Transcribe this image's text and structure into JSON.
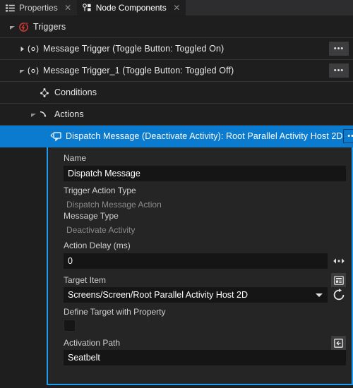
{
  "window": {
    "background": "#1e1e1e",
    "accent": "#0a7bce",
    "panel_border": "#1d9bf0"
  },
  "tabs": [
    {
      "label": "Properties",
      "icon": "list-properties-icon",
      "active": false,
      "close": "✕"
    },
    {
      "label": "Node Components",
      "icon": "node-components-icon",
      "active": true,
      "close": "✕"
    }
  ],
  "tree": [
    {
      "name": "triggers-root",
      "label": "Triggers",
      "icon": "triggers-icon",
      "twisty": "expanded",
      "indent": 0,
      "selected": false,
      "has_menu": false
    },
    {
      "name": "message-trigger",
      "label": "Message Trigger (Toggle Button: Toggled On)",
      "icon": "message-trigger-icon",
      "twisty": "collapsed",
      "indent": 1,
      "selected": false,
      "has_menu": true,
      "menu_label": "•••"
    },
    {
      "name": "message-trigger-1",
      "label": "Message Trigger_1 (Toggle Button: Toggled Off)",
      "icon": "message-trigger-icon",
      "twisty": "expanded",
      "indent": 1,
      "selected": false,
      "has_menu": true,
      "menu_label": "•••"
    },
    {
      "name": "conditions",
      "label": "Conditions",
      "icon": "conditions-icon",
      "twisty": "none",
      "indent": 2,
      "selected": false,
      "has_menu": false
    },
    {
      "name": "actions",
      "label": "Actions",
      "icon": "actions-icon",
      "twisty": "expanded",
      "indent": 2,
      "selected": false,
      "has_menu": false
    },
    {
      "name": "dispatch-message-action",
      "label": "Dispatch Message (Deactivate Activity): Root Parallel Activity Host 2D",
      "icon": "dispatch-message-icon",
      "twisty": "none",
      "indent": 3,
      "selected": true,
      "has_menu": true,
      "menu_label": "•••"
    }
  ],
  "details": {
    "name_field": {
      "label": "Name",
      "value": "Dispatch Message"
    },
    "trigger_action_type": {
      "label": "Trigger Action Type",
      "value": "Dispatch Message Action"
    },
    "message_type": {
      "label": "Message Type",
      "value": "Deactivate Activity"
    },
    "action_delay": {
      "label": "Action Delay (ms)",
      "value": "0",
      "stepper_icon": "horizontal-spinner-icon"
    },
    "target_item": {
      "label": "Target Item",
      "value": "Screens/Screen/Root Parallel Activity Host 2D",
      "picker_icon": "target-picker-icon",
      "goto_icon": "goto-target-icon"
    },
    "define_target_with_property": {
      "label": "Define Target with Property",
      "checked": false
    },
    "activation_path": {
      "label": "Activation Path",
      "value": "Seatbelt",
      "picker_icon": "activation-path-picker-icon"
    }
  }
}
